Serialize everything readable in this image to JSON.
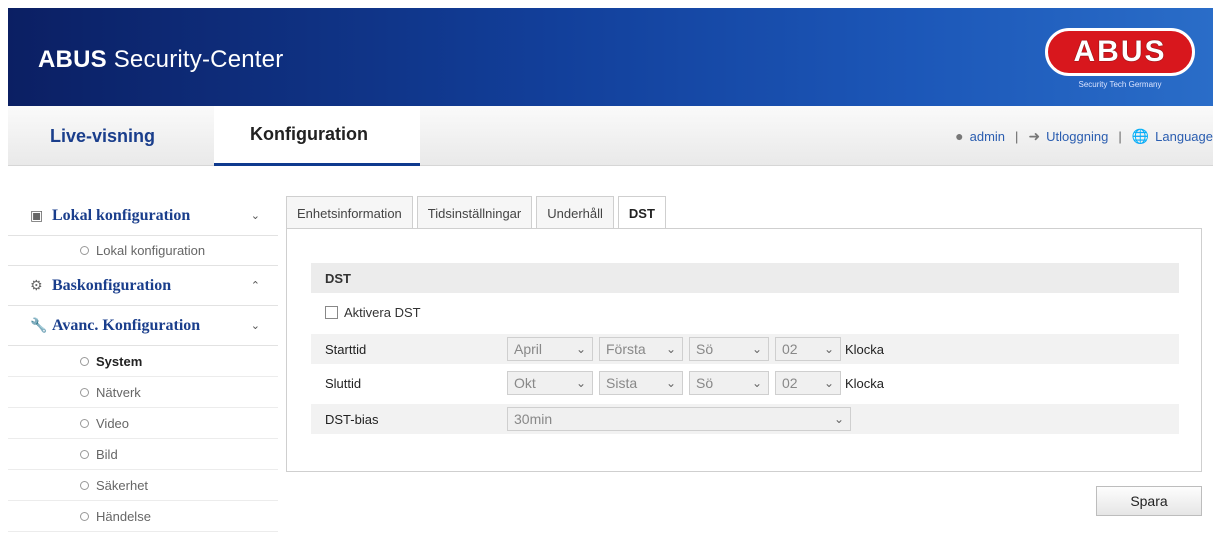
{
  "header": {
    "title_bold": "ABUS",
    "title_rest": "Security-Center",
    "logo_text": "ABUS",
    "logo_tagline": "Security Tech Germany"
  },
  "nav": {
    "live": "Live-visning",
    "config": "Konfiguration",
    "user": "admin",
    "logout": "Utloggning",
    "language": "Language"
  },
  "sidebar": {
    "local_title": "Lokal konfiguration",
    "local_item": "Lokal konfiguration",
    "basic_title": "Baskonfiguration",
    "advanced_title": "Avanc. Konfiguration",
    "items": [
      "System",
      "Nätverk",
      "Video",
      "Bild",
      "Säkerhet",
      "Händelse"
    ]
  },
  "tabs": [
    "Enhetsinformation",
    "Tidsinställningar",
    "Underhåll",
    "DST"
  ],
  "dst": {
    "section_title": "DST",
    "enable_label": "Aktivera DST",
    "start": {
      "label": "Starttid",
      "month": "April",
      "week": "Första",
      "day": "Sö",
      "hour": "02",
      "suffix": "Klocka"
    },
    "end": {
      "label": "Sluttid",
      "month": "Okt",
      "week": "Sista",
      "day": "Sö",
      "hour": "02",
      "suffix": "Klocka"
    },
    "bias": {
      "label": "DST-bias",
      "value": "30min"
    }
  },
  "save_label": "Spara",
  "colors": {
    "header_dark": "#0b1f63",
    "header_light": "#2a6dc8",
    "logo_red": "#d8171d",
    "nav_accent": "#1a3e8c"
  }
}
